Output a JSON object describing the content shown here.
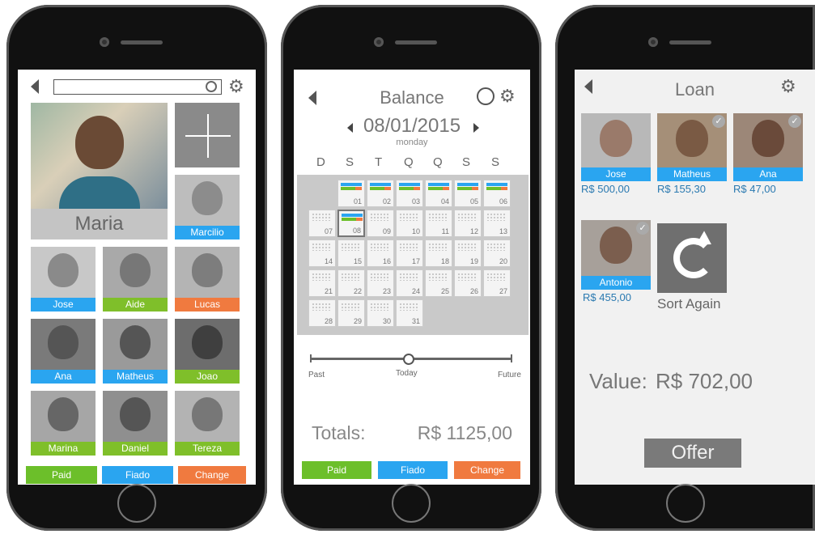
{
  "screen1": {
    "search_placeholder": "",
    "featured_name": "Maria",
    "contacts": [
      {
        "name": "Marcilio",
        "color": "#2aa5f0"
      },
      {
        "name": "Jose",
        "color": "#2aa5f0"
      },
      {
        "name": "Aide",
        "color": "#7fbf2a"
      },
      {
        "name": "Lucas",
        "color": "#f07a3f"
      },
      {
        "name": "Ana",
        "color": "#2aa5f0"
      },
      {
        "name": "Matheus",
        "color": "#2aa5f0"
      },
      {
        "name": "Joao",
        "color": "#7fbf2a"
      },
      {
        "name": "Marina",
        "color": "#7fbf2a"
      },
      {
        "name": "Daniel",
        "color": "#7fbf2a"
      },
      {
        "name": "Tereza",
        "color": "#7fbf2a"
      }
    ],
    "bottom_buttons": [
      "Paid",
      "Fiado",
      "Change"
    ]
  },
  "screen2": {
    "title": "Balance",
    "date": "08/01/2015",
    "weekday": "monday",
    "day_headers": [
      "D",
      "S",
      "T",
      "Q",
      "Q",
      "S",
      "S"
    ],
    "days": [
      "01",
      "02",
      "03",
      "04",
      "05",
      "06",
      "07",
      "08",
      "09",
      "10",
      "11",
      "12",
      "13",
      "14",
      "15",
      "16",
      "17",
      "18",
      "19",
      "20",
      "21",
      "22",
      "23",
      "24",
      "25",
      "26",
      "27",
      "28",
      "29",
      "30",
      "31"
    ],
    "timeline": {
      "past": "Past",
      "today": "Today",
      "future": "Future"
    },
    "totals_label": "Totals:",
    "totals_value": "R$ 1125,00",
    "bottom_buttons": [
      "Paid",
      "Fiado",
      "Change"
    ]
  },
  "screen3": {
    "title": "Loan",
    "people": [
      {
        "name": "Jose",
        "amount": "R$ 500,00"
      },
      {
        "name": "Matheus",
        "amount": "R$ 155,30"
      },
      {
        "name": "Ana",
        "amount": "R$ 47,00"
      },
      {
        "name": "Antonio",
        "amount": "R$ 455,00"
      }
    ],
    "sort_again": "Sort Again",
    "value_label": "Value:",
    "value_amount": "R$ 702,00",
    "offer": "Offer"
  },
  "colors": {
    "blue": "#2aa5f0",
    "green": "#6cbf2a",
    "orange": "#f07a3f",
    "grey": "#7a7a7a"
  }
}
